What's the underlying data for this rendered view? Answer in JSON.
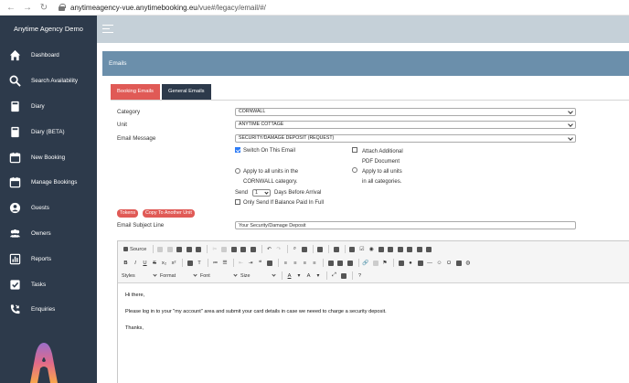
{
  "browser": {
    "url_host": "anytimeagency-vue.anytimebooking.eu",
    "url_path": "/vue#/legacy/email/#/"
  },
  "sidebar": {
    "brand": "Anytime Agency Demo",
    "items": [
      {
        "label": "Dashboard",
        "icon": "home-icon"
      },
      {
        "label": "Search Availability",
        "icon": "search-icon"
      },
      {
        "label": "Diary",
        "icon": "book-icon"
      },
      {
        "label": "Diary (BETA)",
        "icon": "book-icon"
      },
      {
        "label": "New Booking",
        "icon": "calendar-icon"
      },
      {
        "label": "Manage Bookings",
        "icon": "calendar-icon"
      },
      {
        "label": "Guests",
        "icon": "user-icon"
      },
      {
        "label": "Owners",
        "icon": "users-icon"
      },
      {
        "label": "Reports",
        "icon": "chart-icon"
      },
      {
        "label": "Tasks",
        "icon": "checkbox-icon"
      },
      {
        "label": "Enquiries",
        "icon": "phone-icon"
      }
    ]
  },
  "page": {
    "title": "Emails"
  },
  "tabs": [
    {
      "label": "Booking Emails",
      "active": true
    },
    {
      "label": "General Emails",
      "active": false
    }
  ],
  "form": {
    "category": {
      "label": "Category",
      "value": "CORNWALL"
    },
    "unit": {
      "label": "Unit",
      "value": "ANYTIME COTTAGE"
    },
    "email_message": {
      "label": "Email Message",
      "value": "SECURITY/DAMAGE DEPOSIT (REQUEST)"
    },
    "switch_on": {
      "label": "Switch On This Email",
      "checked": true
    },
    "attach_pdf": {
      "label_line1": "Attach Additional",
      "label_line2": "PDF Document",
      "checked": false
    },
    "apply_category": {
      "line1": "Apply to all units in the",
      "line2": "CORNWALL category."
    },
    "apply_all": {
      "line1": "Apply to all units",
      "line2": "in all categories."
    },
    "send": {
      "prefix": "Send",
      "days_value": "1",
      "suffix": "Days Before Arrival"
    },
    "only_balance": {
      "label": "Only Send If Balance Paid In Full",
      "checked": false
    },
    "tokens_button": "Tokens",
    "copy_button": "Copy To Another Unit",
    "subject": {
      "label": "Email Subject Line",
      "value": "Your Security/Damage Deposit"
    }
  },
  "editor": {
    "source_label": "Source",
    "styles_label": "Styles",
    "format_label": "Format",
    "font_label": "Font",
    "size_label": "Size",
    "body": [
      "Hi there,",
      "Please log in to your \"my account\" area and submit your card details in case we neeed to charge a security deposit.",
      "Thanks,"
    ]
  },
  "colors": {
    "sidebar": "#2d3a4b",
    "accent": "#e05a56",
    "header": "#6b8fab",
    "topbar": "#c5d0d8"
  }
}
